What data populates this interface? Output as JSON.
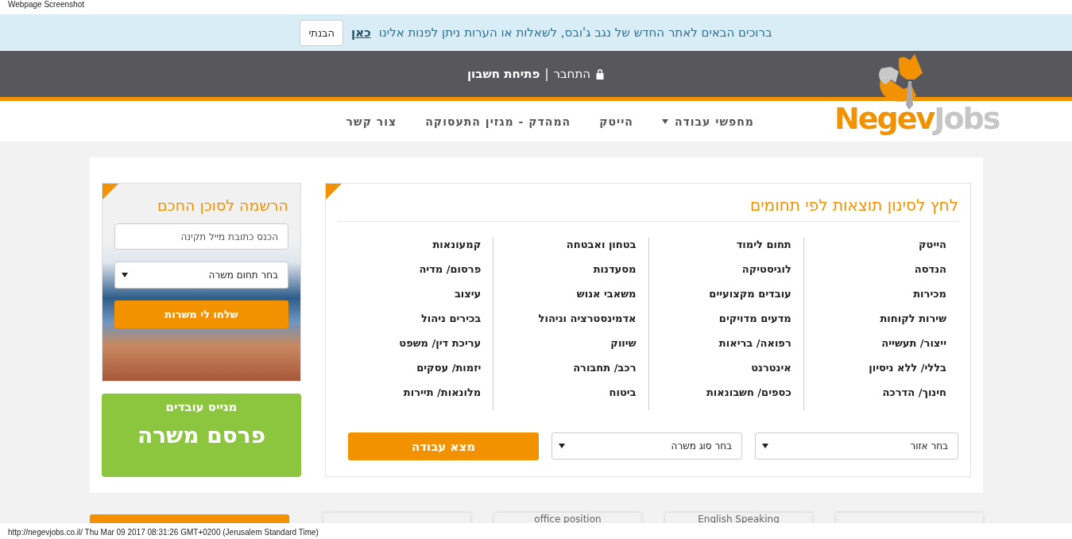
{
  "capture_label": "Webpage Screenshot",
  "banner": {
    "text": "ברוכים הבאים לאתר החדש של נגב ג'ובס, לשאלות או הערות ניתן לפנות אלינו",
    "link": "כאן",
    "button": "הבנתי"
  },
  "account": {
    "login": "התחבר",
    "separator": "|",
    "register": "פתיחת חשבון"
  },
  "logo": {
    "part_1": "Negev",
    "part_2": "Jobs"
  },
  "nav": [
    {
      "label": "מחפשי עבודה",
      "kind": "dropdown"
    },
    {
      "label": "הייטק",
      "kind": "link"
    },
    {
      "label": "המהדק - מגזין התעסוקה",
      "kind": "link"
    },
    {
      "label": "צור קשר",
      "kind": "link"
    }
  ],
  "filter": {
    "title": "לחץ לסינון תוצאות לפי תחומים",
    "columns": [
      [
        "הייטק",
        "הנדסה",
        "מכירות",
        "שירות לקוחות",
        "ייצור/ תעשייה",
        "בללי/ ללא ניסיון",
        "חינוך/ הדרכה"
      ],
      [
        "תחום לימוד",
        "לוגיסטיקה",
        "עובדים מקצועיים",
        "מדעים מדויקים",
        "רפואה/ בריאות",
        "אינטרנט",
        "כספים/ חשבונאות"
      ],
      [
        "בטחון ואבטחה",
        "מסעדנות",
        "משאבי אנוש",
        "אדמינסטרציה וניהול",
        "שיווק",
        "רכב/ תחבורה",
        "ביטוח"
      ],
      [
        "קמעונאות",
        "פרסום/ מדיה",
        "עיצוב",
        "בכירים ניהול",
        "עריכת דין/ משפט",
        "יזמות/ עסקים",
        "מלונאות/ תיירות"
      ]
    ],
    "region_select": "בחר אזור",
    "type_select": "בחר סוג משרה",
    "search_button": "מצא עבודה"
  },
  "agent": {
    "title": "הרשמה לסוכן החכם",
    "email_placeholder": "הכנס כתובת מייל תקינה",
    "field_select": "בחר תחום משרה",
    "button": "שלחו לי משרות"
  },
  "employer": {
    "subtitle": "מגייס עובדים",
    "button": "פרסם משרה"
  },
  "tags": [
    {
      "kind": "blank"
    },
    {
      "kind": "text",
      "label": "English Speaking"
    },
    {
      "kind": "text",
      "label": "office position"
    },
    {
      "kind": "blank"
    }
  ],
  "status_bar": "http://negevjobs.co.il/ Thu Mar 09 2017 08:31:26 GMT+0200 (Jerusalem Standard Time)"
}
